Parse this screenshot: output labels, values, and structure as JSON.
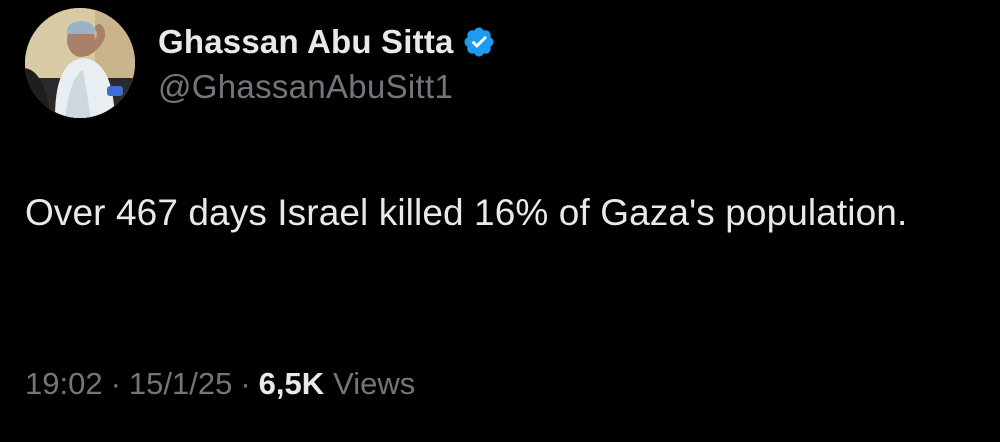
{
  "author": {
    "display_name": "Ghassan Abu Sitta",
    "handle": "@GhassanAbuSitt1",
    "verified": true,
    "verified_color": "#1d9bf0"
  },
  "tweet": {
    "text": "Over 467 days Israel killed 16% of Gaza's population."
  },
  "meta": {
    "time": "19:02",
    "separator": "·",
    "date": "15/1/25",
    "views_count": "6,5K",
    "views_label": "Views"
  },
  "colors": {
    "background": "#000000",
    "primary_text": "#e7e9ea",
    "secondary_text": "#71767b"
  }
}
